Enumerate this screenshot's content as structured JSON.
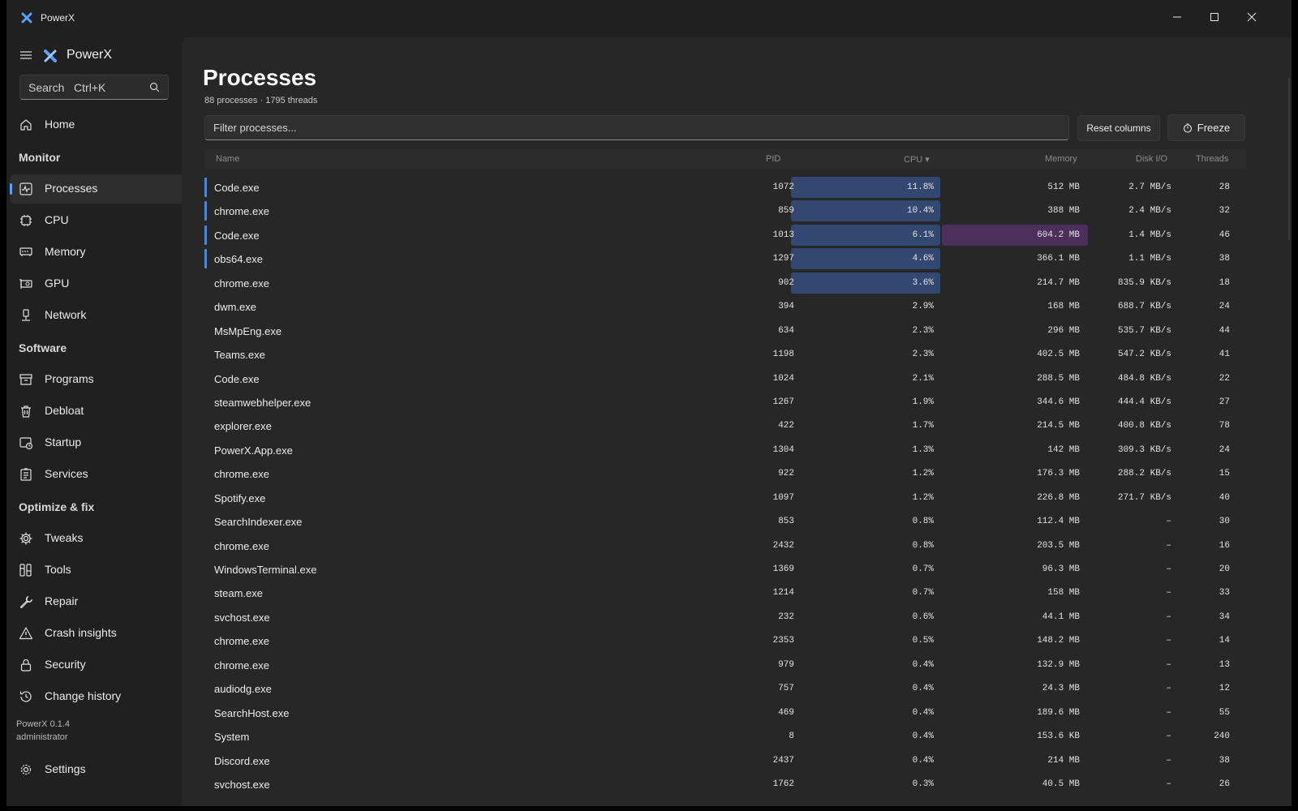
{
  "window": {
    "title": "PowerX"
  },
  "sidebar": {
    "brand": "PowerX",
    "search_placeholder": "Search   Ctrl+K",
    "home": "Home",
    "sections": {
      "monitor": "Monitor",
      "software": "Software",
      "optimize": "Optimize & fix"
    },
    "items": {
      "processes": "Processes",
      "cpu": "CPU",
      "memory": "Memory",
      "gpu": "GPU",
      "network": "Network",
      "programs": "Programs",
      "debloat": "Debloat",
      "startup": "Startup",
      "services": "Services",
      "tweaks": "Tweaks",
      "tools": "Tools",
      "repair": "Repair",
      "crash": "Crash insights",
      "security": "Security",
      "history": "Change history",
      "settings": "Settings"
    },
    "version": "PowerX 0.1.4",
    "user": "administrator",
    "active": "processes"
  },
  "main": {
    "title": "Processes",
    "subtitle": "88 processes · 1795 threads",
    "filter_placeholder": "Filter processes...",
    "reset_label": "Reset columns",
    "freeze_label": "Freeze",
    "columns": {
      "name": "Name",
      "pid": "PID",
      "cpu": "CPU ▾",
      "memory": "Memory",
      "disk": "Disk I/O",
      "threads": "Threads"
    }
  },
  "colors": {
    "accent": "#5aa0ff",
    "cpu_bar": "#334870",
    "mem_bar": "#4e2f5c"
  },
  "processes": [
    {
      "name": "Code.exe",
      "pid": "1072",
      "cpu": "11.8%",
      "mem": "512 MB",
      "disk": "2.7 MB/s",
      "threads": "28",
      "hot": true
    },
    {
      "name": "chrome.exe",
      "pid": "859",
      "cpu": "10.4%",
      "mem": "388 MB",
      "disk": "2.4 MB/s",
      "threads": "32",
      "hot": true
    },
    {
      "name": "Code.exe",
      "pid": "1013",
      "cpu": "6.1%",
      "mem": "604.2 MB",
      "disk": "1.4 MB/s",
      "threads": "46",
      "hot": true,
      "memhot": true
    },
    {
      "name": "obs64.exe",
      "pid": "1297",
      "cpu": "4.6%",
      "mem": "366.1 MB",
      "disk": "1.1 MB/s",
      "threads": "38",
      "hot": true
    },
    {
      "name": "chrome.exe",
      "pid": "902",
      "cpu": "3.6%",
      "mem": "214.7 MB",
      "disk": "835.9 KB/s",
      "threads": "18",
      "cpuhot": true
    },
    {
      "name": "dwm.exe",
      "pid": "394",
      "cpu": "2.9%",
      "mem": "168 MB",
      "disk": "688.7 KB/s",
      "threads": "24"
    },
    {
      "name": "MsMpEng.exe",
      "pid": "634",
      "cpu": "2.3%",
      "mem": "296 MB",
      "disk": "535.7 KB/s",
      "threads": "44"
    },
    {
      "name": "Teams.exe",
      "pid": "1198",
      "cpu": "2.3%",
      "mem": "402.5 MB",
      "disk": "547.2 KB/s",
      "threads": "41"
    },
    {
      "name": "Code.exe",
      "pid": "1024",
      "cpu": "2.1%",
      "mem": "288.5 MB",
      "disk": "484.8 KB/s",
      "threads": "22"
    },
    {
      "name": "steamwebhelper.exe",
      "pid": "1267",
      "cpu": "1.9%",
      "mem": "344.6 MB",
      "disk": "444.4 KB/s",
      "threads": "27"
    },
    {
      "name": "explorer.exe",
      "pid": "422",
      "cpu": "1.7%",
      "mem": "214.5 MB",
      "disk": "400.8 KB/s",
      "threads": "78"
    },
    {
      "name": "PowerX.App.exe",
      "pid": "1304",
      "cpu": "1.3%",
      "mem": "142 MB",
      "disk": "309.3 KB/s",
      "threads": "24"
    },
    {
      "name": "chrome.exe",
      "pid": "922",
      "cpu": "1.2%",
      "mem": "176.3 MB",
      "disk": "288.2 KB/s",
      "threads": "15"
    },
    {
      "name": "Spotify.exe",
      "pid": "1097",
      "cpu": "1.2%",
      "mem": "226.8 MB",
      "disk": "271.7 KB/s",
      "threads": "40"
    },
    {
      "name": "SearchIndexer.exe",
      "pid": "853",
      "cpu": "0.8%",
      "mem": "112.4 MB",
      "disk": "–",
      "threads": "30"
    },
    {
      "name": "chrome.exe",
      "pid": "2432",
      "cpu": "0.8%",
      "mem": "203.5 MB",
      "disk": "–",
      "threads": "16"
    },
    {
      "name": "WindowsTerminal.exe",
      "pid": "1369",
      "cpu": "0.7%",
      "mem": "96.3 MB",
      "disk": "–",
      "threads": "20"
    },
    {
      "name": "steam.exe",
      "pid": "1214",
      "cpu": "0.7%",
      "mem": "158 MB",
      "disk": "–",
      "threads": "33"
    },
    {
      "name": "svchost.exe",
      "pid": "232",
      "cpu": "0.6%",
      "mem": "44.1 MB",
      "disk": "–",
      "threads": "34"
    },
    {
      "name": "chrome.exe",
      "pid": "2353",
      "cpu": "0.5%",
      "mem": "148.2 MB",
      "disk": "–",
      "threads": "14"
    },
    {
      "name": "chrome.exe",
      "pid": "979",
      "cpu": "0.4%",
      "mem": "132.9 MB",
      "disk": "–",
      "threads": "13"
    },
    {
      "name": "audiodg.exe",
      "pid": "757",
      "cpu": "0.4%",
      "mem": "24.3 MB",
      "disk": "–",
      "threads": "12"
    },
    {
      "name": "SearchHost.exe",
      "pid": "469",
      "cpu": "0.4%",
      "mem": "189.6 MB",
      "disk": "–",
      "threads": "55"
    },
    {
      "name": "System",
      "pid": "8",
      "cpu": "0.4%",
      "mem": "153.6 KB",
      "disk": "–",
      "threads": "240"
    },
    {
      "name": "Discord.exe",
      "pid": "2437",
      "cpu": "0.4%",
      "mem": "214 MB",
      "disk": "–",
      "threads": "38"
    },
    {
      "name": "svchost.exe",
      "pid": "1762",
      "cpu": "0.3%",
      "mem": "40.5 MB",
      "disk": "–",
      "threads": "26"
    }
  ]
}
